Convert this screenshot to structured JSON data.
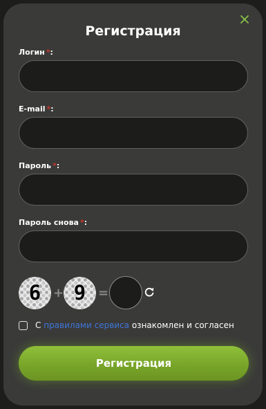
{
  "dialog": {
    "title": "Регистрация",
    "close_icon": "close-icon",
    "accent_color": "#8bc34a"
  },
  "fields": {
    "login": {
      "label": "Логин",
      "required_mark": "*",
      "value": "",
      "placeholder": ""
    },
    "email": {
      "label": "E-mail",
      "required_mark": "*",
      "value": "",
      "placeholder": ""
    },
    "password": {
      "label": "Пароль",
      "required_mark": "*",
      "value": "",
      "placeholder": ""
    },
    "password_repeat": {
      "label": "Пароль снова",
      "required_mark": "*",
      "value": "",
      "placeholder": ""
    }
  },
  "captcha": {
    "operand_a": "6",
    "operator": "+",
    "operand_b": "9",
    "equals": "=",
    "answer": "",
    "refresh_icon": "refresh-icon"
  },
  "agreement": {
    "checked": false,
    "prefix": "С",
    "link_text": "правилами сервиса",
    "suffix": "ознакомлен и согласен",
    "link_color": "#3f76d9"
  },
  "submit": {
    "label": "Регистрация",
    "color": "#7cab2c"
  },
  "labels_suffix": ":"
}
